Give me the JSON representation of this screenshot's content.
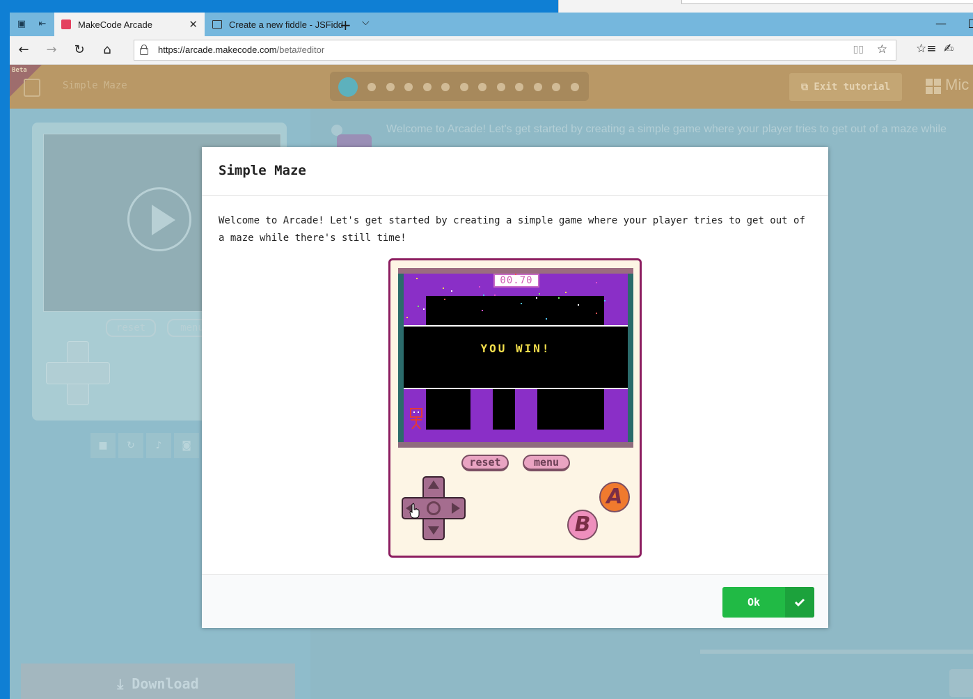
{
  "browser": {
    "tabs": [
      {
        "title": "MakeCode Arcade",
        "active": true
      },
      {
        "title": "Create a new fiddle - JSFidd",
        "active": false
      }
    ],
    "url_host": "https://arcade.makecode.com",
    "url_path": "/beta#editor"
  },
  "makecode": {
    "beta_label": "Beta",
    "project_title": "Simple Maze",
    "exit_tutorial": "Exit tutorial",
    "brand": "Mic",
    "sim_buttons": [
      "reset",
      "menu"
    ],
    "download": "Download",
    "tutorial_text": "Welcome to Arcade! Let's get started by creating a simple game where your player tries to get out of a maze while",
    "step_count": 13,
    "current_step": "1"
  },
  "modal": {
    "title": "Simple Maze",
    "body": "Welcome to Arcade! Let's get started by creating a simple game where your player tries to get out of a maze while there's still time!",
    "ok_label": "Ok"
  },
  "game": {
    "timer": "00.70",
    "message": "YOU WIN!",
    "buttons": {
      "reset": "reset",
      "menu": "menu",
      "a": "A",
      "b": "B"
    }
  },
  "colors": {
    "ok_green": "#21ba45",
    "device_border": "#8c1d60",
    "screen_purple": "#8a2fc7",
    "win_yellow": "#f4e04d"
  }
}
